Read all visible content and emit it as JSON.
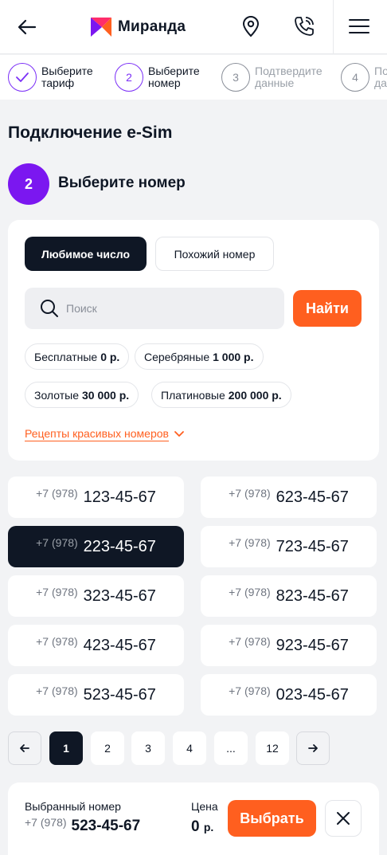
{
  "header": {
    "brand": "Миранда",
    "brand_colors": [
      "#ff5f1f",
      "#7b17f0"
    ],
    "icons": [
      "back-arrow-icon",
      "location-pin-icon",
      "phone-call-icon",
      "menu-icon"
    ]
  },
  "steps": [
    {
      "number": "1",
      "label1": "Выберите",
      "label2": "тариф",
      "state": "done"
    },
    {
      "number": "2",
      "label1": "Выберите",
      "label2": "номер",
      "state": "active"
    },
    {
      "number": "3",
      "label1": "Подтвердите",
      "label2": "данные",
      "state": "pending"
    },
    {
      "number": "4",
      "label1": "Подтвердите",
      "label2": "данные",
      "state": "pending"
    }
  ],
  "page": {
    "title": "Подключение e-Sim",
    "step_number": "2",
    "step_title": "Выберите номер"
  },
  "filter": {
    "tabs": [
      {
        "label": "Любимое число",
        "selected": true
      },
      {
        "label": "Похожий номер",
        "selected": false
      }
    ],
    "search_placeholder": "Поиск",
    "search_button": "Найти",
    "categories": [
      {
        "name": "Бесплатные",
        "price": "0 р."
      },
      {
        "name": "Серебряные",
        "price": "1 000 р."
      },
      {
        "name": "Золотые",
        "price": "30 000 р."
      },
      {
        "name": "Платиновые",
        "price": "200 000 р."
      }
    ],
    "recipes_link": "Рецепты красивых номеров"
  },
  "numbers": [
    {
      "prefix": "+7 (978)",
      "number": "123-45-67",
      "selected": false
    },
    {
      "prefix": "+7 (978)",
      "number": "623-45-67",
      "selected": false
    },
    {
      "prefix": "+7 (978)",
      "number": "223-45-67",
      "selected": true
    },
    {
      "prefix": "+7 (978)",
      "number": "723-45-67",
      "selected": false
    },
    {
      "prefix": "+7 (978)",
      "number": "323-45-67",
      "selected": false
    },
    {
      "prefix": "+7 (978)",
      "number": "823-45-67",
      "selected": false
    },
    {
      "prefix": "+7 (978)",
      "number": "423-45-67",
      "selected": false
    },
    {
      "prefix": "+7 (978)",
      "number": "923-45-67",
      "selected": false
    },
    {
      "prefix": "+7 (978)",
      "number": "523-45-67",
      "selected": false
    },
    {
      "prefix": "+7 (978)",
      "number": "023-45-67",
      "selected": false
    }
  ],
  "pagination": {
    "pages": [
      "1",
      "2",
      "3",
      "4",
      "...",
      "12"
    ],
    "current": "1"
  },
  "selection": {
    "label": "Выбранный номер",
    "prefix": "+7 (978)",
    "number": "523-45-67",
    "price_label": "Цена",
    "price_value": "0",
    "price_unit": "р.",
    "choose_button": "Выбрать"
  },
  "colors": {
    "accent_orange": "#ff5f1f",
    "accent_purple": "#7b17f0",
    "dark": "#0f1725"
  }
}
